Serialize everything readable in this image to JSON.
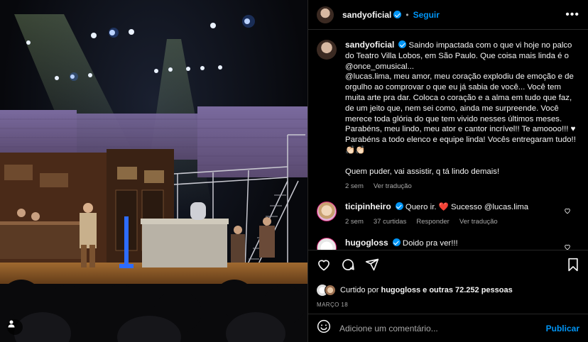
{
  "post": {
    "author": "sandyoficial",
    "follow_label": "Seguir",
    "caption_lines": [
      "Saindo impactada com o que vi hoje no palco do Teatro Villa Lobos, em São Paulo. Que coisa mais linda é o @once_omusical...",
      "@lucas.lima, meu amor, meu coração explodiu de emoção e de orgulho ao comprovar o que eu já sabia de você... Você tem muita arte pra dar. Coloca o coração e a alma em tudo que faz, de um jeito que, nem sei como, ainda me surpreende. Você merece toda glória do que tem vivido nesses últimos meses. Parabéns, meu lindo, meu ator e cantor incrível!! Te amoooo!!! ♥",
      "Parabéns a todo elenco e equipe linda! Vocês entregaram tudo!! 👏🏻👏🏻",
      "Quem puder, vai assistir, q tá lindo demais!"
    ],
    "caption_time": "2 sem",
    "see_translation": "Ver tradução"
  },
  "comments": [
    {
      "user": "ticipinheiro",
      "text": "Quero ir. ❤️ Sucesso @lucas.lima",
      "time": "2 sem",
      "likes": "37 curtidas",
      "reply": "Responder",
      "translate": "Ver tradução"
    },
    {
      "user": "hugogloss",
      "text": "Doido pra ver!!!"
    }
  ],
  "likes": {
    "prefix": "Curtido por",
    "user": "hugogloss",
    "suffix": "e outras 72.252 pessoas"
  },
  "date": "MARÇO 18",
  "composer": {
    "placeholder": "Adicione um comentário...",
    "publish": "Publicar"
  },
  "colors": {
    "accent": "#0095f6",
    "heart": "#ff3040",
    "background": "#000000",
    "muted": "#a8a8a8"
  },
  "icons": [
    "heart-icon",
    "comment-icon",
    "share-icon",
    "save-icon",
    "emoji-icon",
    "more-options-icon",
    "verified-badge-icon",
    "user-tag-icon"
  ]
}
